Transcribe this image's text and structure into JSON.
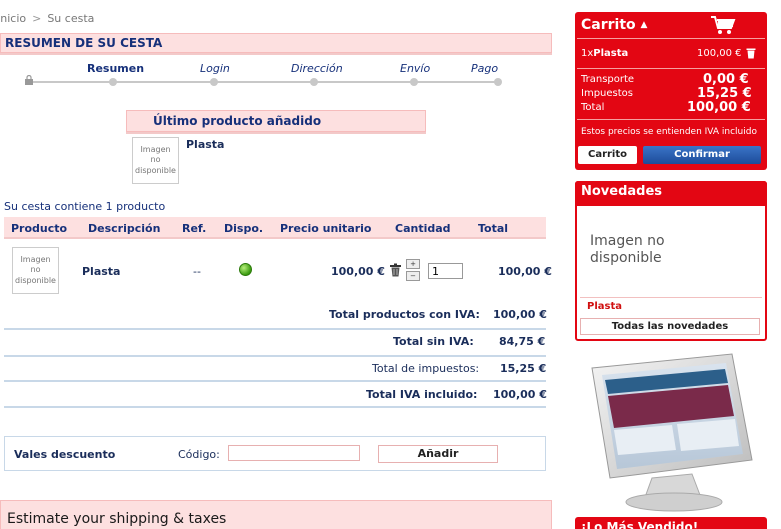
{
  "breadcrumb": {
    "home": "Inicio",
    "separator": ">",
    "current": "Su cesta"
  },
  "summary_title": "RESUMEN DE SU CESTA",
  "steps": [
    {
      "label": "Resumen",
      "active": true
    },
    {
      "label": "Login",
      "active": false
    },
    {
      "label": "Dirección",
      "active": false
    },
    {
      "label": "Envío",
      "active": false
    },
    {
      "label": "Pago",
      "active": false
    }
  ],
  "last_added": {
    "heading": "Último producto añadido",
    "image_text": "Imagen no disponible",
    "product_name": "Plasta"
  },
  "cart_count_text": "Su cesta contiene 1 producto",
  "table": {
    "headers": [
      "Producto",
      "Descripción",
      "Ref.",
      "Dispo.",
      "Precio unitario",
      "Cantidad",
      "Total"
    ],
    "row": {
      "image_text": "Imagen no disponible",
      "description": "Plasta",
      "ref": "--",
      "unit_price": "100,00 €",
      "quantity": "1",
      "total": "100,00 €"
    }
  },
  "totals": {
    "products_with_tax_label": "Total productos con IVA:",
    "products_with_tax_value": "100,00 €",
    "without_tax_label": "Total sin IVA:",
    "without_tax_value": "84,75 €",
    "taxes_label": "Total de impuestos:",
    "taxes_value": "15,25 €",
    "with_tax_label": "Total IVA incluido:",
    "with_tax_value": "100,00 €"
  },
  "vouchers": {
    "title": "Vales descuento",
    "code_label": "Código:",
    "code_value": "",
    "add_button": "Añadir"
  },
  "estimate_title": "Estimate your shipping & taxes",
  "sidebar_cart": {
    "title": "Carrito",
    "item_qty": "1x",
    "item_name": "Plasta",
    "item_price": "100,00 €",
    "shipping_label": "Transporte",
    "shipping_value": "0,00 €",
    "taxes_label": "Impuestos",
    "taxes_value": "15,25 €",
    "total_label": "Total",
    "total_value": "100,00 €",
    "note": "Estos precios se entienden IVA incluido",
    "cart_button": "Carrito",
    "confirm_button": "Confirmar",
    "accent_color": "#e30613"
  },
  "novedades": {
    "title": "Novedades",
    "image_text": "Imagen no disponible",
    "product_name": "Plasta",
    "all_button": "Todas las novedades"
  },
  "more_sold_title": "¡Lo Más Vendido!"
}
